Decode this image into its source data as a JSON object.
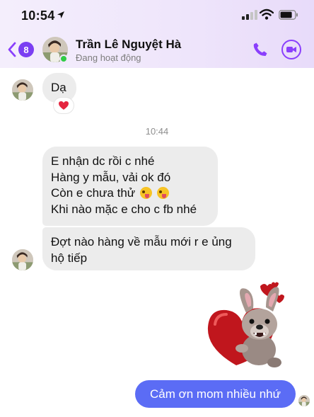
{
  "status_bar": {
    "time": "10:54"
  },
  "header": {
    "unread_count": "8",
    "contact_name": "Trần Lê Nguyệt Hà",
    "contact_status": "Đang hoạt động"
  },
  "messages": {
    "incoming_1": "Dạ",
    "reaction_1": "heart",
    "timestamp": "10:44",
    "incoming_2_lines": [
      "E nhận dc rồi c nhé",
      "Hàng y mẫu, vải ok đó",
      "Còn e chưa thử",
      "Khi nào mặc e cho c fb nhé"
    ],
    "incoming_3_lines": [
      "Đợt nào hàng về mẫu mới r e ủng",
      "hộ tiếp"
    ],
    "outgoing_1": "Cảm ơn mom nhiều nhứ"
  },
  "colors": {
    "accent": "#8a3ffc",
    "badge": "#7b3ff2",
    "outgoing_bubble": "#5b6cf5",
    "incoming_bubble": "#ececec",
    "presence": "#31cc46"
  },
  "icons": {
    "back": "chevron-left-icon",
    "call": "phone-icon",
    "video": "video-camera-icon",
    "reaction": "heart-icon",
    "sticker": "dog-with-heart-sticker"
  }
}
